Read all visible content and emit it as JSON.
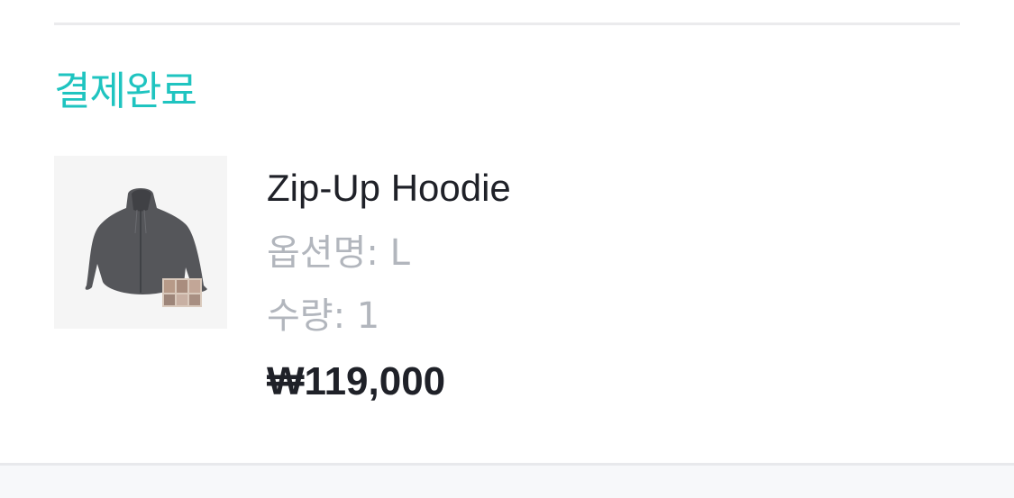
{
  "order": {
    "status": "결제완료",
    "status_color": "#1fc4c0"
  },
  "product": {
    "image_icon": "hoodie-product-image",
    "name": "Zip-Up Hoodie",
    "option_text": "옵션명: L",
    "quantity_text": "수량: 1",
    "price": "₩119,000"
  },
  "colors": {
    "text_primary": "#1f2128",
    "text_secondary": "#b2b6bd",
    "divider": "#ebebed"
  }
}
